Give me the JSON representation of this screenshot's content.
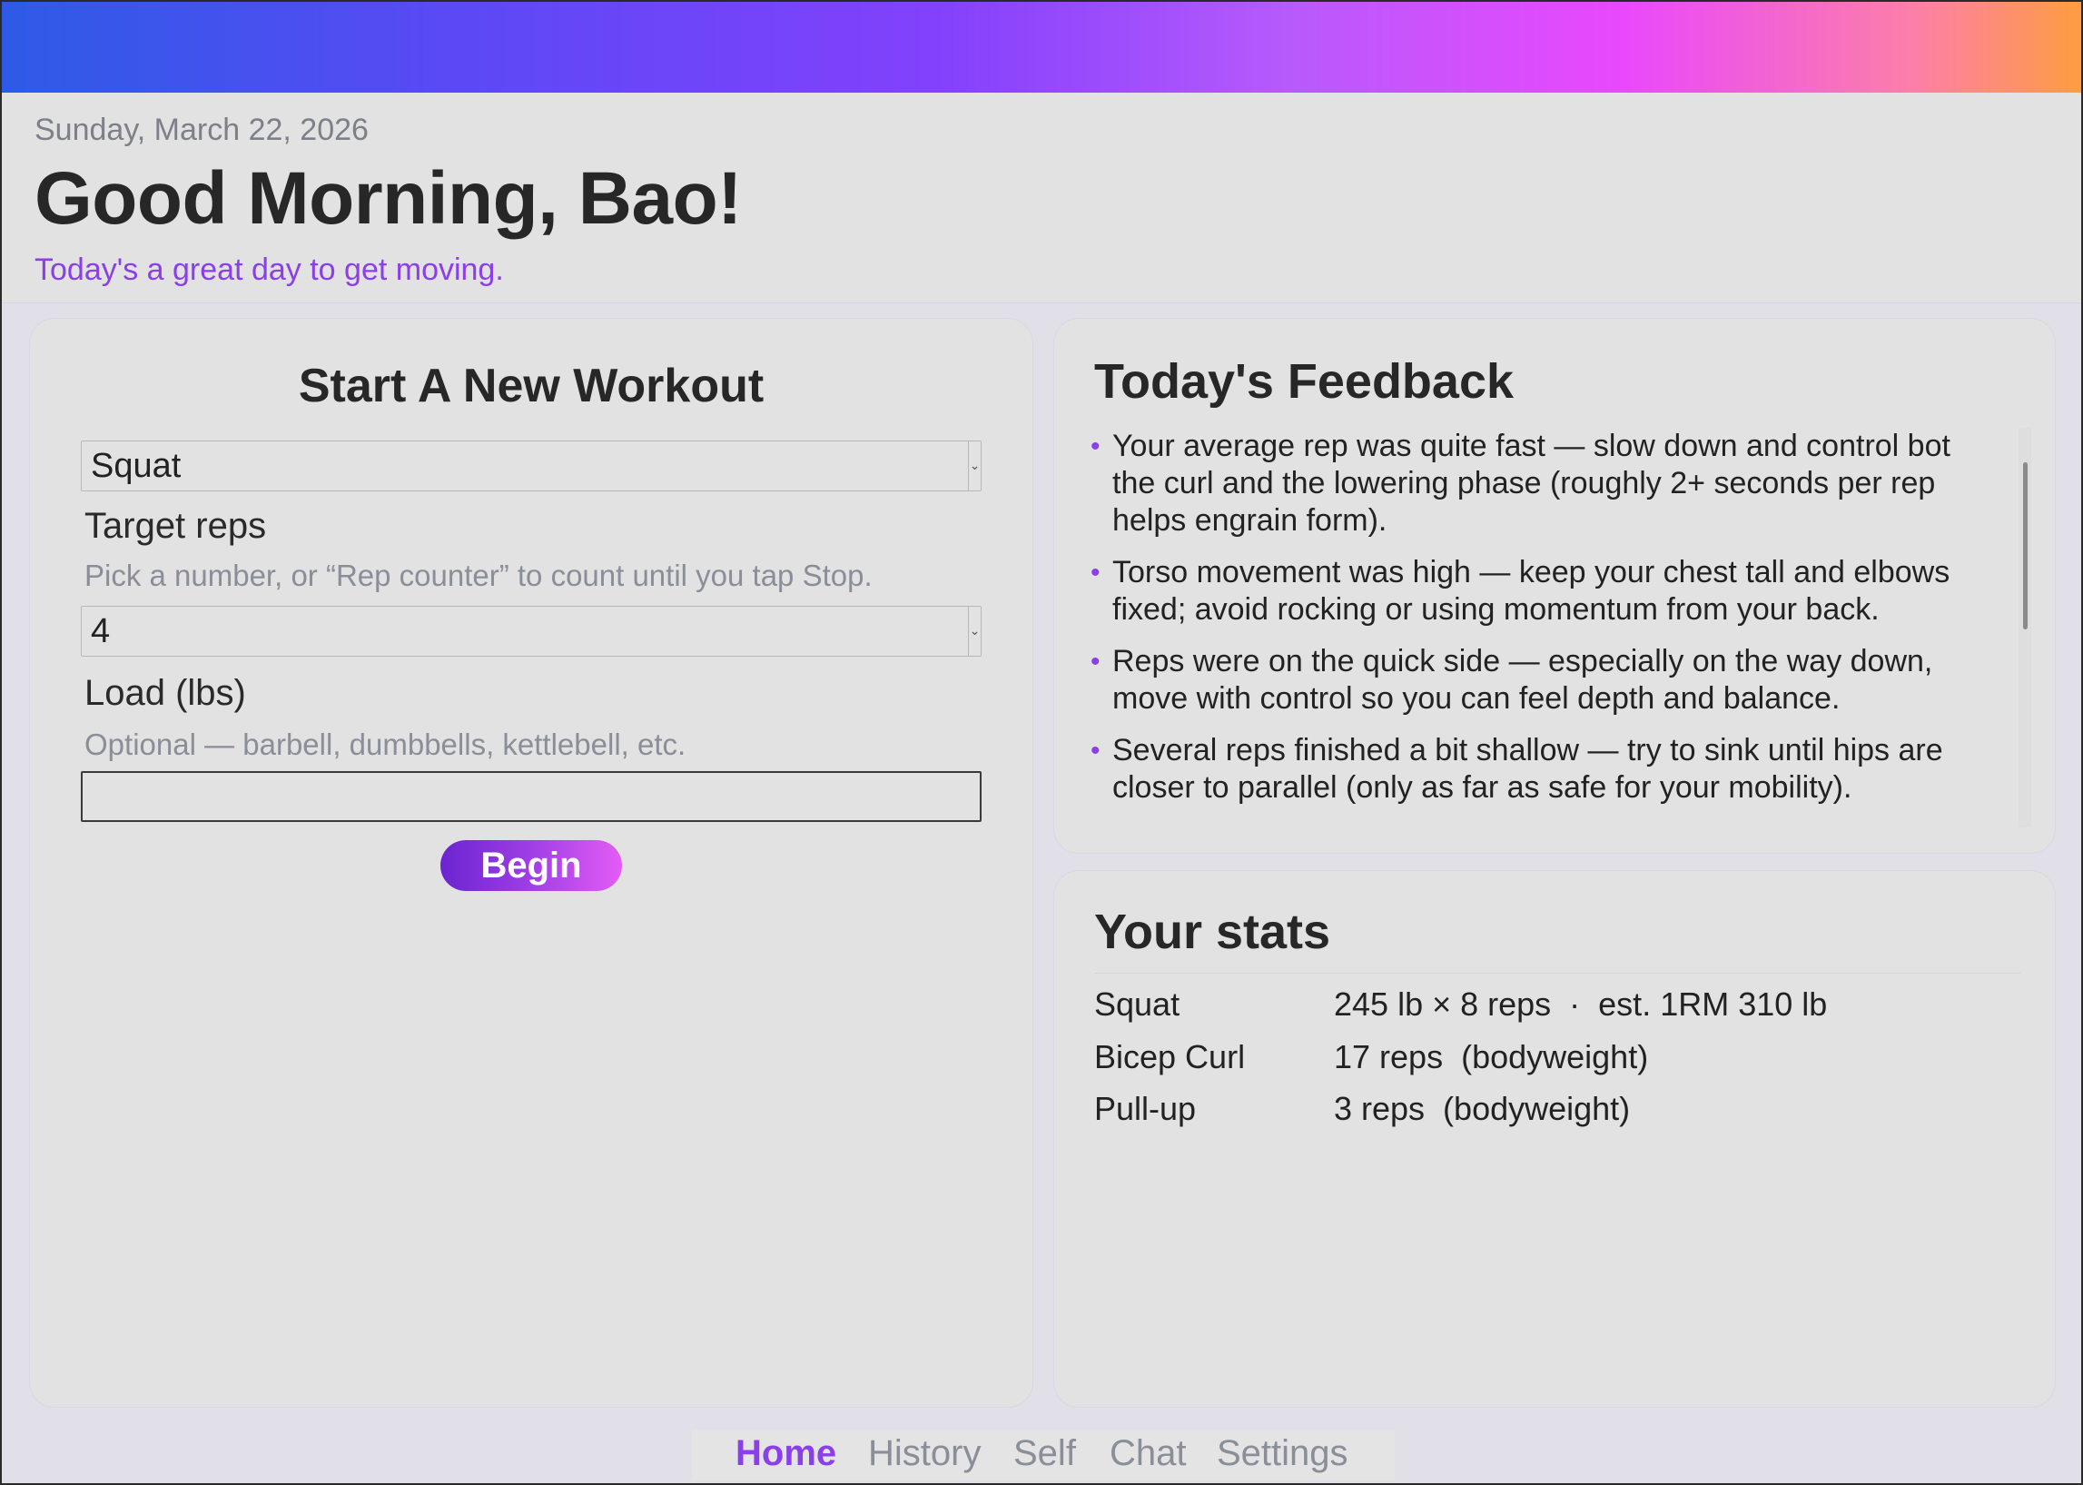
{
  "header": {
    "date": "Sunday, March 22, 2026",
    "greeting": "Good Morning, Bao!",
    "subtitle": "Today's a great day to get moving."
  },
  "workout": {
    "title": "Start A New Workout",
    "exercise_selected": "Squat",
    "target_reps_label": "Target reps",
    "target_reps_hint": "Pick a number, or “Rep counter” to count until you tap Stop.",
    "target_reps_selected": "4",
    "load_label": "Load (lbs)",
    "load_hint": "Optional — barbell, dumbbells, kettlebell, etc.",
    "load_value": "",
    "begin_label": "Begin"
  },
  "feedback": {
    "title": "Today's Feedback",
    "items": [
      "Your average rep was quite fast — slow down and control bot the curl and the lowering phase (roughly 2+ seconds per rep helps engrain form).",
      "Torso movement was high — keep your chest tall and elbows fixed; avoid rocking or using momentum from your back.",
      "Reps were on the quick side — especially on the way down, move with control so you can feel depth and balance.",
      "Several reps finished a bit shallow — try to sink until hips are closer to parallel (only as far as safe for your mobility)."
    ]
  },
  "stats": {
    "title": "Your stats",
    "rows": [
      {
        "name": "Squat",
        "value": "245 lb × 8 reps  ·  est. 1RM 310 lb"
      },
      {
        "name": "Bicep Curl",
        "value": "17 reps  (bodyweight)"
      },
      {
        "name": "Pull-up",
        "value": "3 reps  (bodyweight)"
      }
    ]
  },
  "nav": {
    "home": "Home",
    "history": "History",
    "self": "Self",
    "chat": "Chat",
    "settings": "Settings",
    "active": "home"
  },
  "colors": {
    "accent": "#8a3fe8",
    "background": "#e2e2e2"
  }
}
